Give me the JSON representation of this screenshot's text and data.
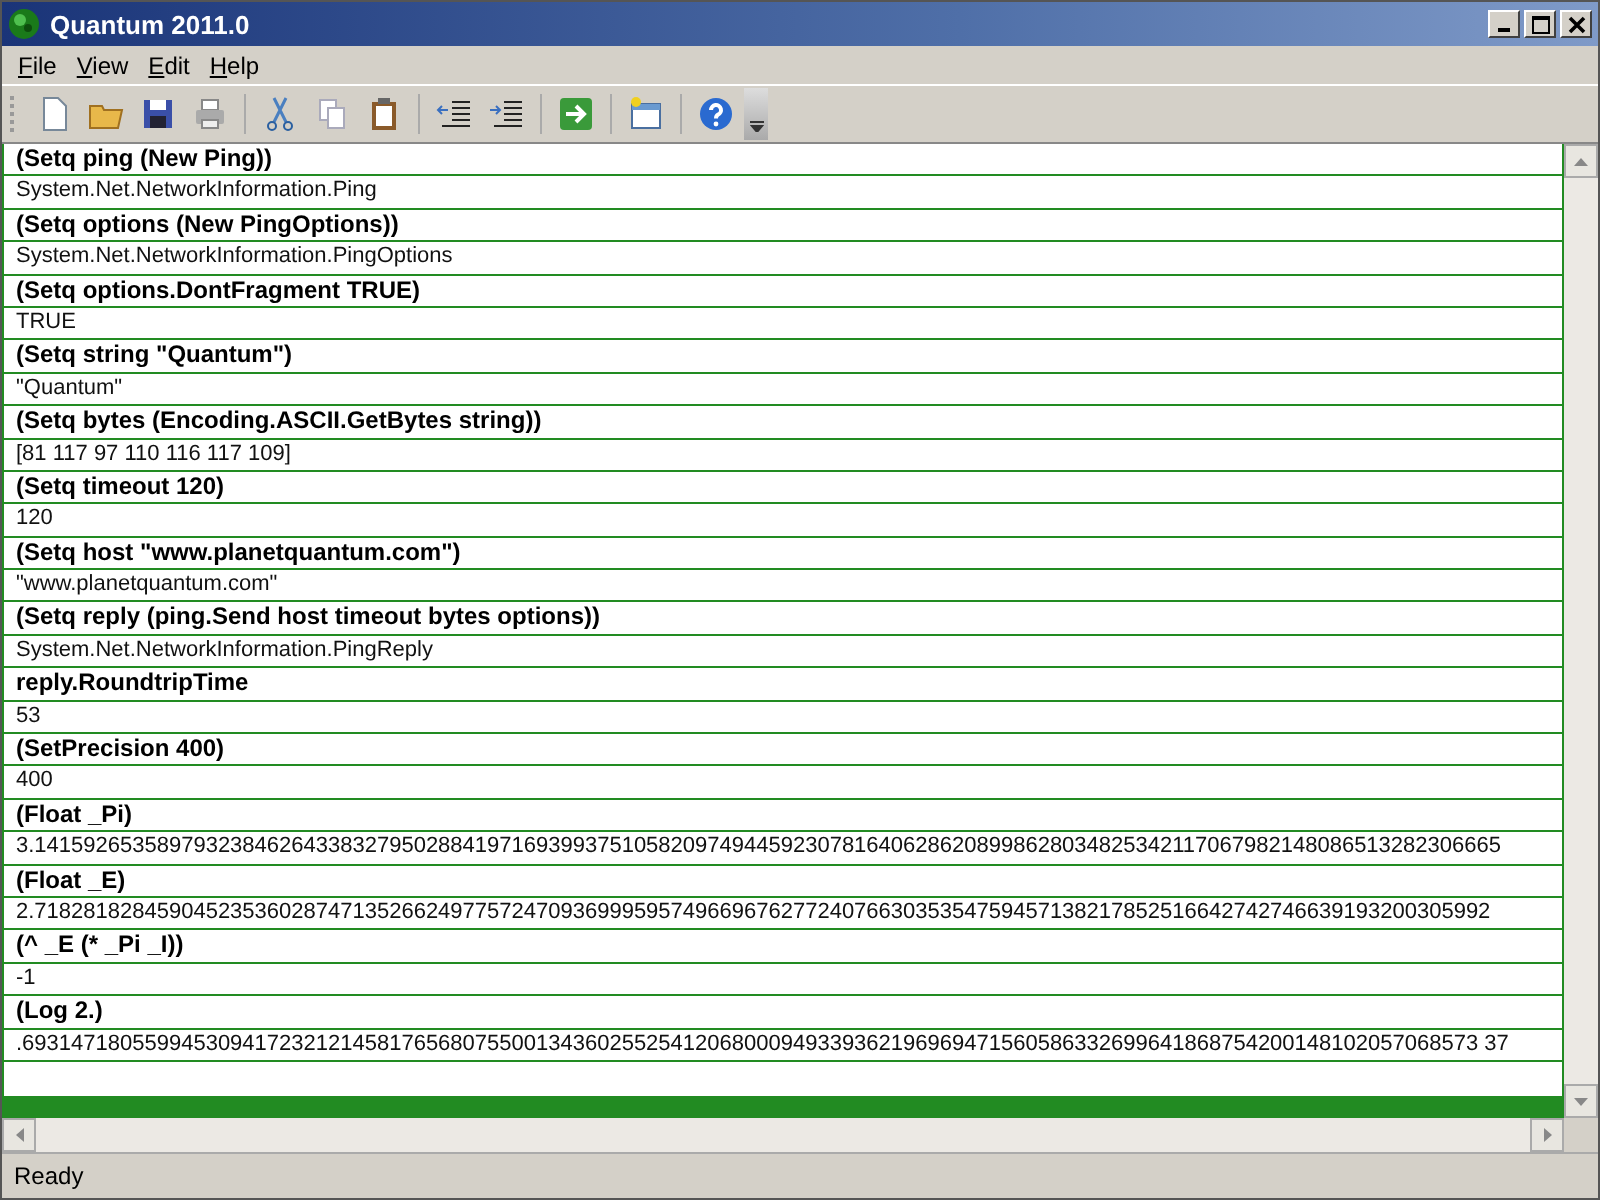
{
  "window": {
    "title": "Quantum 2011.0"
  },
  "menu": [
    "File",
    "View",
    "Edit",
    "Help"
  ],
  "entries": [
    {
      "kind": "input",
      "text": "(Setq ping (New Ping))"
    },
    {
      "kind": "output",
      "text": "System.Net.NetworkInformation.Ping"
    },
    {
      "kind": "input",
      "text": "(Setq options (New PingOptions))"
    },
    {
      "kind": "output",
      "text": "System.Net.NetworkInformation.PingOptions"
    },
    {
      "kind": "input",
      "text": "(Setq options.DontFragment TRUE)"
    },
    {
      "kind": "output",
      "text": "TRUE"
    },
    {
      "kind": "input",
      "text": "(Setq string \"Quantum\")"
    },
    {
      "kind": "output",
      "text": "\"Quantum\""
    },
    {
      "kind": "input",
      "text": "(Setq bytes (Encoding.ASCII.GetBytes string))"
    },
    {
      "kind": "output",
      "text": "[81 117 97 110 116 117 109]"
    },
    {
      "kind": "input",
      "text": "(Setq timeout 120)"
    },
    {
      "kind": "output",
      "text": "120"
    },
    {
      "kind": "input",
      "text": "(Setq host \"www.planetquantum.com\")"
    },
    {
      "kind": "output",
      "text": "\"www.planetquantum.com\""
    },
    {
      "kind": "input",
      "text": "(Setq reply (ping.Send host timeout bytes options))"
    },
    {
      "kind": "output",
      "text": "System.Net.NetworkInformation.PingReply"
    },
    {
      "kind": "input",
      "text": "reply.RoundtripTime"
    },
    {
      "kind": "output",
      "text": "53"
    },
    {
      "kind": "input",
      "text": "(SetPrecision 400)"
    },
    {
      "kind": "output",
      "text": "400"
    },
    {
      "kind": "input",
      "text": "(Float _Pi)"
    },
    {
      "kind": "output",
      "text": "3.141592653589793238462643383279502884197169399375105820974944592307816406286208998628034825342117067982148086513282306665"
    },
    {
      "kind": "input",
      "text": "(Float _E)"
    },
    {
      "kind": "output",
      "text": "2.71828182845904523536028747135266249775724709369995957496696762772407663035354759457138217852516642742746639193200305992"
    },
    {
      "kind": "input",
      "text": "(^ _E (* _Pi _I))"
    },
    {
      "kind": "output",
      "text": "-1"
    },
    {
      "kind": "input",
      "text": "(Log 2.)"
    },
    {
      "kind": "output",
      "text": ".69314718055994530941723212145817656807550013436025525412068000949339362196969471560586332699641868754200148102057068573 37"
    }
  ],
  "status_bar": "Ready"
}
